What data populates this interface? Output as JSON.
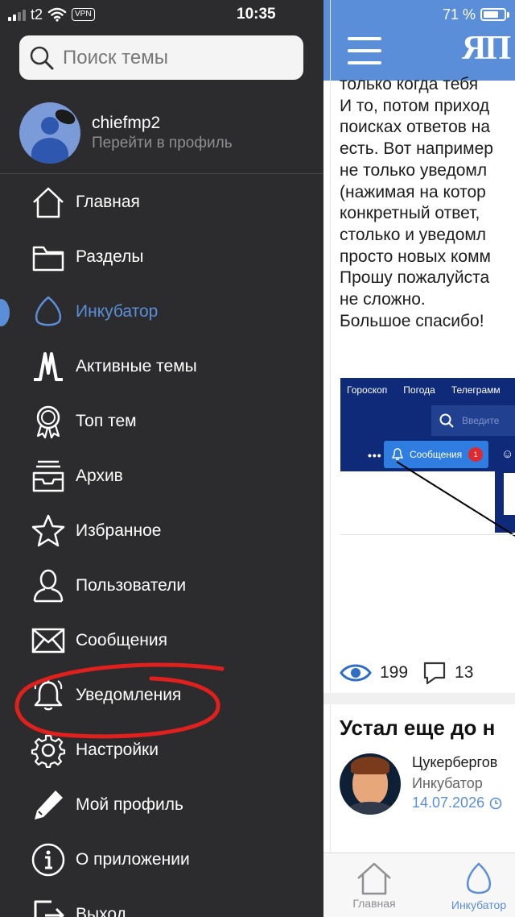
{
  "status_bar": {
    "carrier": "t2",
    "vpn": "VPN",
    "time": "10:35",
    "battery": "71 %"
  },
  "search": {
    "placeholder": "Поиск темы"
  },
  "profile": {
    "name": "chiefmp2",
    "subtitle": "Перейти в профиль"
  },
  "menu": [
    {
      "label": "Главная",
      "icon": "home-icon"
    },
    {
      "label": "Разделы",
      "icon": "folder-icon"
    },
    {
      "label": "Инкубатор",
      "icon": "egg-icon",
      "active": true
    },
    {
      "label": "Активные темы",
      "icon": "activity-icon"
    },
    {
      "label": "Топ тем",
      "icon": "award-icon"
    },
    {
      "label": "Архив",
      "icon": "archive-icon"
    },
    {
      "label": "Избранное",
      "icon": "star-icon"
    },
    {
      "label": "Пользователи",
      "icon": "user-icon"
    },
    {
      "label": "Сообщения",
      "icon": "envelope-icon"
    },
    {
      "label": "Уведомления",
      "icon": "bell-icon"
    },
    {
      "label": "Настройки",
      "icon": "gear-icon"
    },
    {
      "label": "Мой профиль",
      "icon": "pencil-icon"
    },
    {
      "label": "О приложении",
      "icon": "info-icon"
    },
    {
      "label": "Выход",
      "icon": "exit-icon"
    }
  ],
  "app": {
    "logo": "ЯП",
    "post_lines": [
      "только когда тебя",
      "И то, потом приход",
      "поисках ответов на",
      "есть. Вот например",
      "не только уведомл",
      "(нажимая на котор",
      "конкретный ответ,",
      "столько и уведомл",
      "просто новых комм",
      "Прошу пожалуйста",
      "не сложно.",
      "Большое спасибо!"
    ],
    "embedded_screenshot": {
      "nav": [
        "Гороскоп",
        "Погода",
        "Телеграмм"
      ],
      "search_placeholder": "Введите",
      "dots": "•••",
      "messages_label": "Сообщения",
      "messages_badge": "1"
    },
    "stats": {
      "views": "199",
      "comments": "13"
    },
    "card": {
      "title": "Устал еще до н",
      "author": "Цукербергов",
      "category": "Инкубатор",
      "date": "14.07.2026"
    },
    "tabbar": {
      "home": "Главная",
      "incubator": "Инкубатор"
    }
  },
  "colors": {
    "drawer_bg": "#2c2c2e",
    "accent": "#5b8ed8",
    "annotation": "#e0201c"
  }
}
